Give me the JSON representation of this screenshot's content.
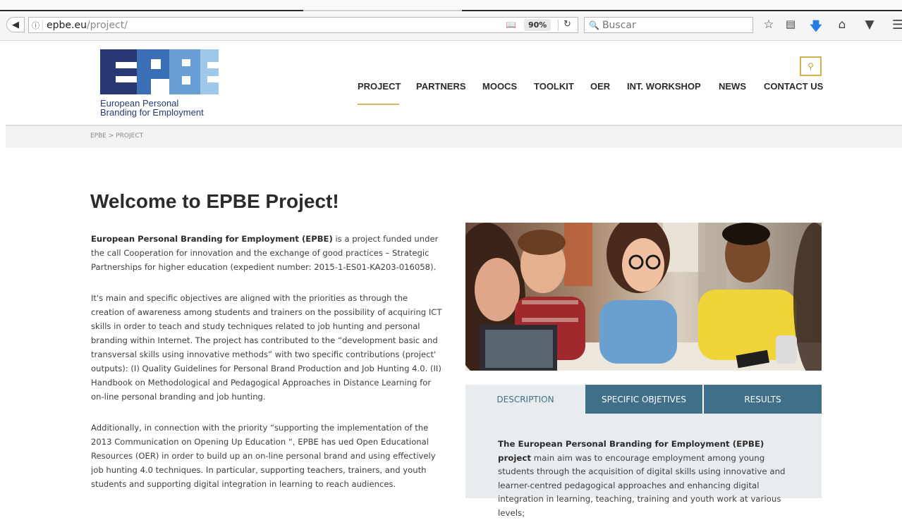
{
  "browser": {
    "url_host": "epbe.eu",
    "url_path": "/project/",
    "zoom": "90%",
    "search_placeholder": "Buscar"
  },
  "site": {
    "logo_tagline_1": "European Personal",
    "logo_tagline_2": "Branding for Employment",
    "nav": [
      "PROJECT",
      "PARTNERS",
      "MOOCS",
      "TOOLKIT",
      "OER",
      "INT. WORKSHOP",
      "NEWS",
      "CONTACT US"
    ],
    "nav_active": "PROJECT",
    "breadcrumb": "EPBE > PROJECT"
  },
  "colors": {
    "brand_dark": "#273873",
    "brand_mid": "#3a6eb5",
    "brand_light": "#9fc7ea",
    "accent_gold": "#d4b14a",
    "tab_blue": "#3f6f89"
  },
  "content": {
    "title": "Welcome to EPBE Project!",
    "p1_bold": "European Personal Branding for Employment (EPBE)",
    "p1_rest": " is a project funded under the call Cooperation for innovation and the exchange of good practices – Strategic Partnerships for higher education (expedient number: 2015-1-ES01-KA203-016058).",
    "p2": "It's main and specific objectives are aligned with the priorities as through the creation of awareness among students and trainers on the possibility of acquiring ICT skills in order to teach and study techniques related to job hunting and personal branding within Internet. The project has contributed to the “development basic and transversal skills using innovative methods” with two specific contributions (project' outputs): (I) Quality Guidelines for Personal Brand Production and Job Hunting 4.0. (II) Handbook on Methodological and Pedagogical Approaches in Distance Learning for on-line personal branding and job hunting.",
    "p3": "Additionally, in connection with the priority “supporting the implementation of the 2013 Communication on Opening Up Education “, EPBE has ued Open Educational Resources (OER) in order to build up an on-line personal brand and using effectively job hunting 4.0 techniques. In particular, supporting teachers, trainers, and youth students and supporting digital integration in learning to reach audiences."
  },
  "tabs": {
    "items": [
      "DESCRIPTION",
      "SPECIFIC OBJETIVES",
      "RESULTS"
    ],
    "active": "DESCRIPTION",
    "panel_bold": "The European Personal Branding for Employment (EPBE) project",
    "panel_rest": " main aim was to encourage employment among young students through the acquisition of digital skills using innovative and learner-centred pedagogical approaches and enhancing digital integration in learning, teaching, training and youth work at various levels;"
  }
}
